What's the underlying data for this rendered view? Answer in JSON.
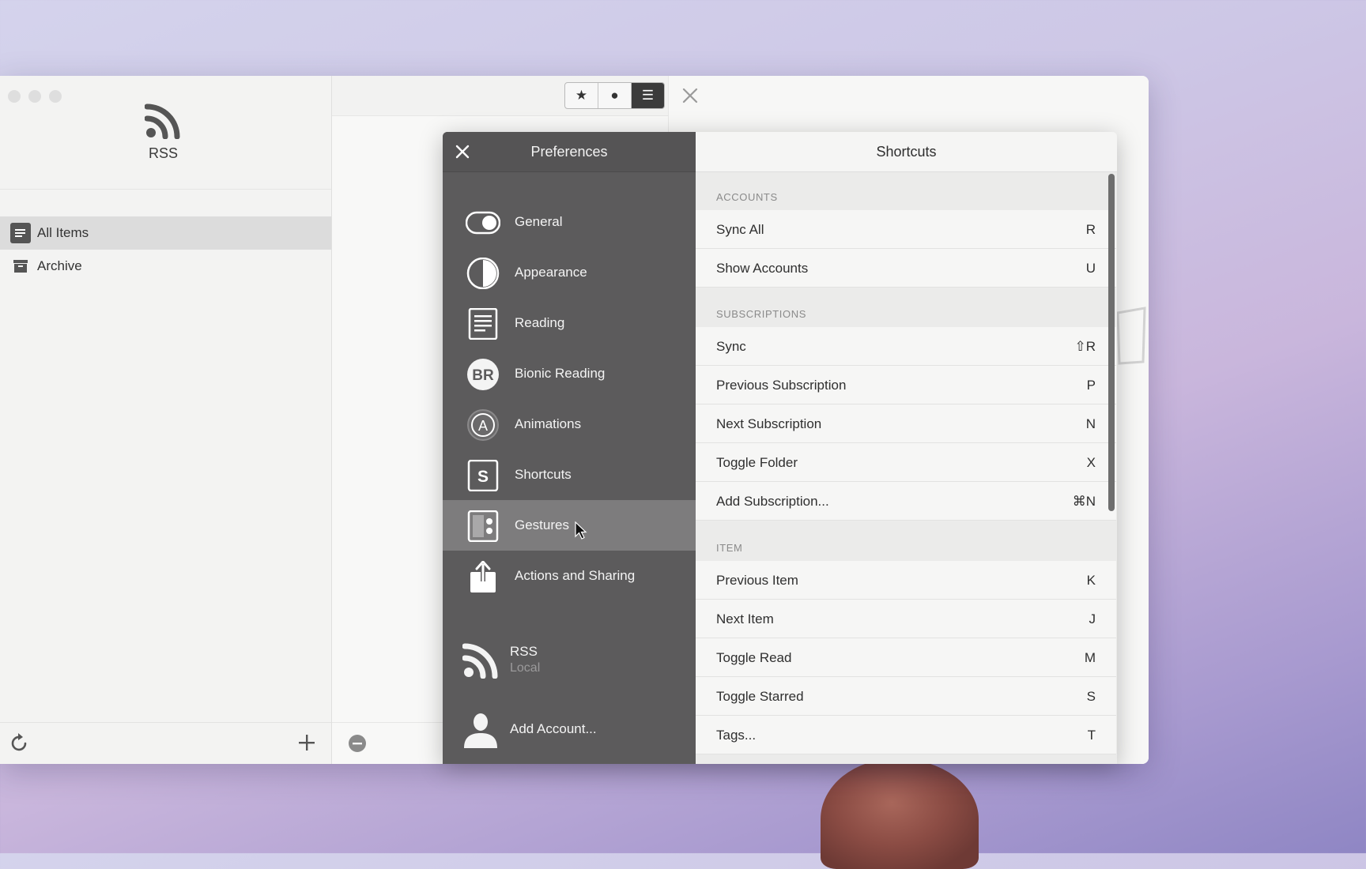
{
  "sidebar": {
    "app_name": "RSS",
    "items": [
      {
        "label": "All Items",
        "icon": "list-icon"
      },
      {
        "label": "Archive",
        "icon": "archive-box-icon"
      }
    ]
  },
  "middle": {
    "segments": [
      "★",
      "●",
      "☰"
    ]
  },
  "preferences": {
    "title": "Preferences",
    "nav": [
      {
        "label": "General",
        "icon": "toggle-icon"
      },
      {
        "label": "Appearance",
        "icon": "half-circle-icon"
      },
      {
        "label": "Reading",
        "icon": "document-icon"
      },
      {
        "label": "Bionic Reading",
        "icon": "br-badge-icon"
      },
      {
        "label": "Animations",
        "icon": "a-circle-icon"
      },
      {
        "label": "Shortcuts",
        "icon": "s-square-icon"
      },
      {
        "label": "Gestures",
        "icon": "gestures-icon"
      },
      {
        "label": "Actions and Sharing",
        "icon": "share-icon"
      }
    ],
    "selected": "Gestures",
    "account": {
      "name": "RSS",
      "type": "Local"
    },
    "add_account": "Add Account..."
  },
  "shortcuts": {
    "title": "Shortcuts",
    "sections": [
      {
        "header": "ACCOUNTS",
        "rows": [
          {
            "label": "Sync All",
            "key": "R"
          },
          {
            "label": "Show Accounts",
            "key": "U"
          }
        ]
      },
      {
        "header": "SUBSCRIPTIONS",
        "rows": [
          {
            "label": "Sync",
            "key": "⇧R"
          },
          {
            "label": "Previous Subscription",
            "key": "P"
          },
          {
            "label": "Next Subscription",
            "key": "N"
          },
          {
            "label": "Toggle Folder",
            "key": "X"
          },
          {
            "label": "Add Subscription...",
            "key": "⌘N"
          }
        ]
      },
      {
        "header": "ITEM",
        "rows": [
          {
            "label": "Previous Item",
            "key": "K"
          },
          {
            "label": "Next Item",
            "key": "J"
          },
          {
            "label": "Toggle Read",
            "key": "M"
          },
          {
            "label": "Toggle Starred",
            "key": "S"
          },
          {
            "label": "Tags...",
            "key": "T"
          }
        ]
      }
    ]
  },
  "colors": {
    "prefs_sidebar": "#5c5b5c",
    "prefs_selected": "#7d7c7d",
    "window_bg": "#f5f5f4"
  }
}
